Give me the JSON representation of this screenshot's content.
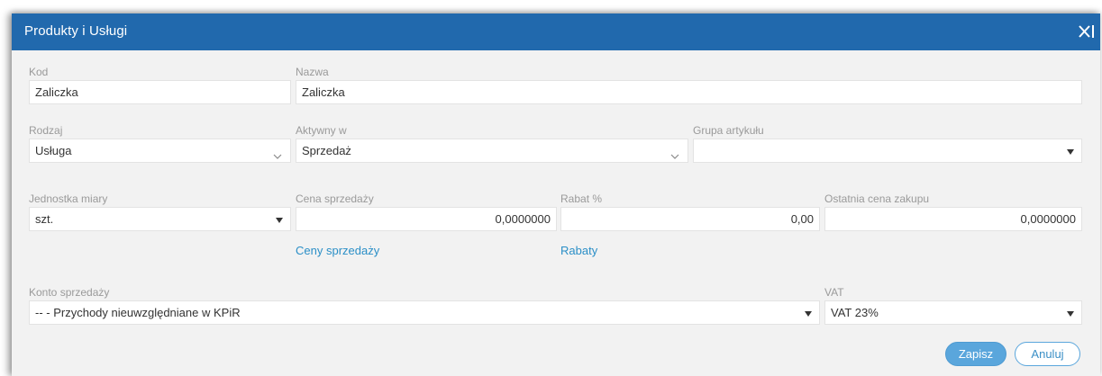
{
  "dialog": {
    "title": "Produkty i Usługi",
    "close_icon": "close-icon"
  },
  "fields": {
    "kod": {
      "label": "Kod",
      "value": "Zaliczka"
    },
    "nazwa": {
      "label": "Nazwa",
      "value": "Zaliczka"
    },
    "rodzaj": {
      "label": "Rodzaj",
      "value": "Usługa"
    },
    "aktywny_w": {
      "label": "Aktywny w",
      "value": "Sprzedaż"
    },
    "grupa_artykulu": {
      "label": "Grupa artykułu",
      "value": ""
    },
    "jednostka_miary": {
      "label": "Jednostka miary",
      "value": "szt."
    },
    "cena_sprzedazy": {
      "label": "Cena sprzedaży",
      "value": "0,0000000"
    },
    "rabat": {
      "label": "Rabat %",
      "value": "0,00"
    },
    "ostatnia_cena_zakupu": {
      "label": "Ostatnia cena zakupu",
      "value": "0,0000000"
    },
    "konto_sprzedazy": {
      "label": "Konto sprzedaży",
      "value": "-- - Przychody nieuwzględniane w KPiR"
    },
    "vat": {
      "label": "VAT",
      "value": "VAT 23%"
    }
  },
  "links": {
    "ceny_sprzedazy": "Ceny sprzedaży",
    "rabaty": "Rabaty"
  },
  "buttons": {
    "save": "Zapisz",
    "cancel": "Anuluj"
  },
  "colors": {
    "titlebar": "#2169ad",
    "link": "#2b8fc7",
    "primary_button": "#5aa6dc"
  }
}
